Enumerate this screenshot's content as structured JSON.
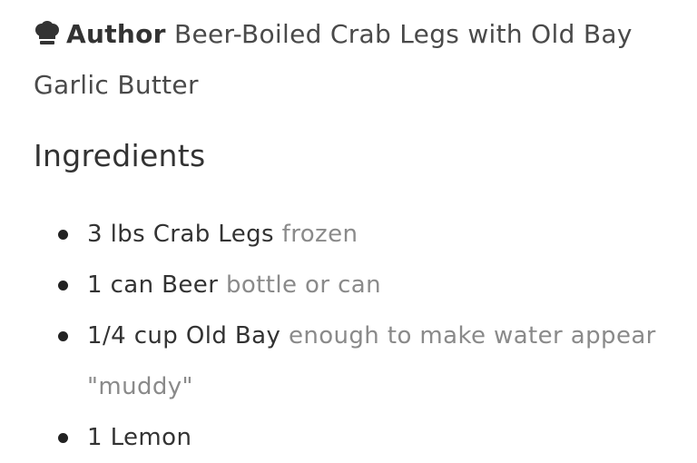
{
  "author": {
    "icon": "chef-hat-icon",
    "label": "Author",
    "value": "Beer-Boiled Crab Legs with Old Bay Garlic Butter"
  },
  "ingredients_section": {
    "title": "Ingredients",
    "items": [
      {
        "main": "3 lbs Crab Legs",
        "note": "frozen"
      },
      {
        "main": "1 can Beer",
        "note": "bottle or can"
      },
      {
        "main": "1/4 cup Old Bay",
        "note": "enough to make water appear \"muddy\""
      },
      {
        "main": "1 Lemon",
        "note": ""
      }
    ]
  },
  "colors": {
    "text": "#333333",
    "note_text": "#8a8a8a",
    "bullet": "#222222"
  }
}
